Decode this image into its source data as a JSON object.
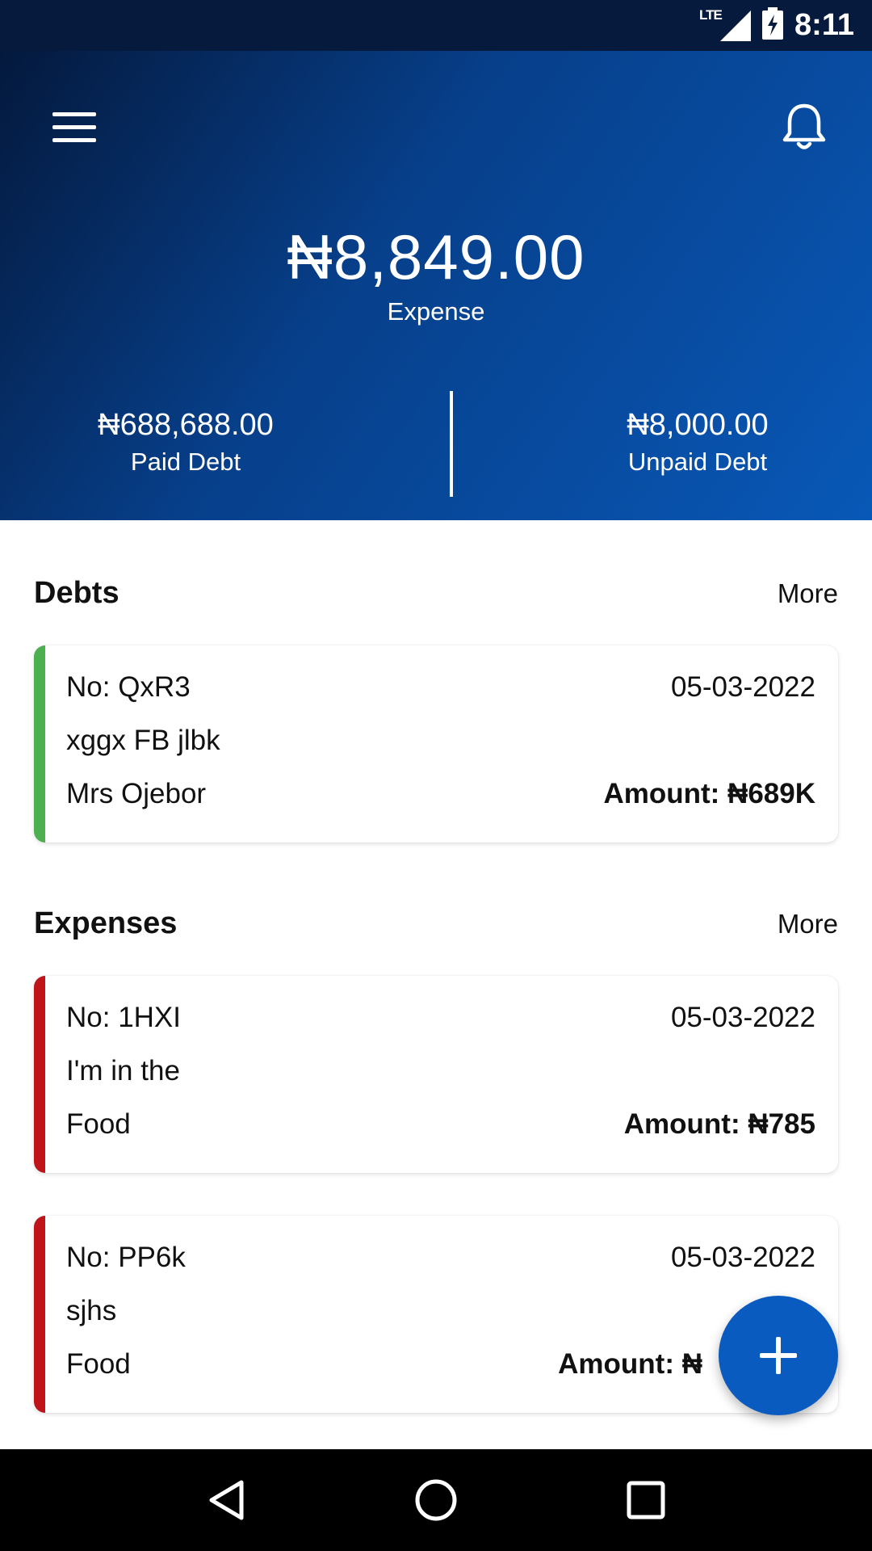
{
  "status_bar": {
    "network": "LTE",
    "time": "8:11"
  },
  "header": {
    "expense_total": "₦8,849.00",
    "expense_label": "Expense",
    "paid_debt": {
      "value": "₦688,688.00",
      "label": "Paid Debt"
    },
    "unpaid_debt": {
      "value": "₦8,000.00",
      "label": "Unpaid Debt"
    }
  },
  "debts": {
    "title": "Debts",
    "more": "More",
    "items": [
      {
        "no": "No: QxR3",
        "date": "05-03-2022",
        "description": "xggx FB jlbk",
        "name": "Mrs Ojebor",
        "amount": "Amount:  ₦689K",
        "accent": "#4caf50"
      }
    ]
  },
  "expenses": {
    "title": "Expenses",
    "more": "More",
    "items": [
      {
        "no": "No: 1HXI",
        "date": "05-03-2022",
        "description": "I'm in the",
        "category": "Food",
        "amount": "Amount:  ₦785",
        "accent": "#c0141b"
      },
      {
        "no": "No: PP6k",
        "date": "05-03-2022",
        "description": "sjhs",
        "category": "Food",
        "amount": "Amount:  ₦",
        "accent": "#c0141b"
      }
    ]
  },
  "icons": {
    "menu": "menu-icon",
    "bell": "bell-icon",
    "fab": "plus-icon",
    "nav_back": "back-triangle-icon",
    "nav_home": "home-circle-icon",
    "nav_recents": "recents-square-icon"
  },
  "colors": {
    "primary": "#0a5bc0",
    "header_dark": "#04193d",
    "debt_accent": "#4caf50",
    "expense_accent": "#c0141b"
  }
}
